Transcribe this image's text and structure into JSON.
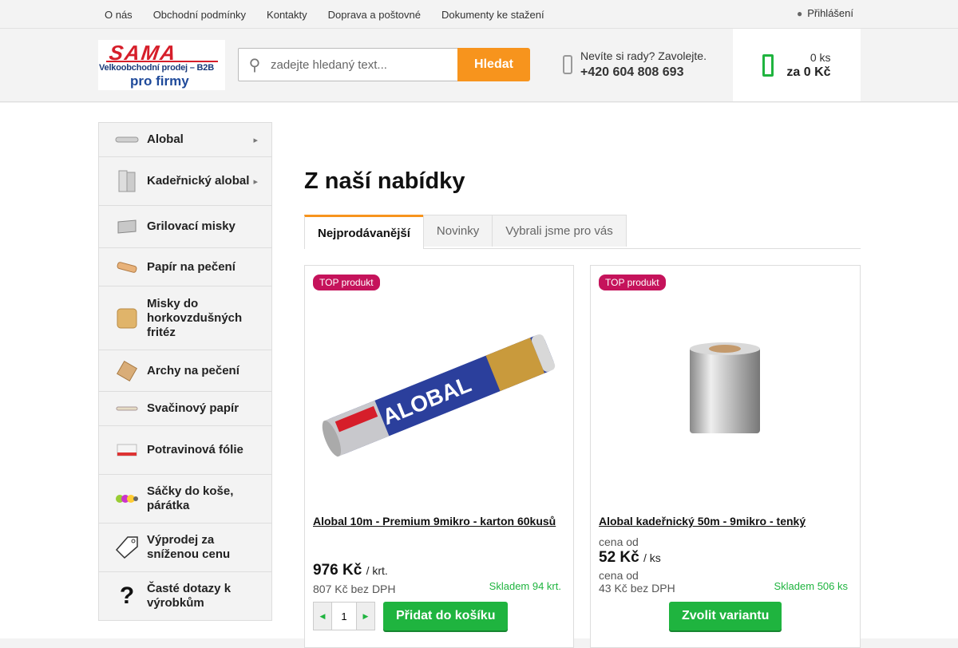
{
  "topnav": [
    "O nás",
    "Obchodní podmínky",
    "Kontakty",
    "Doprava a poštovné",
    "Dokumenty ke stažení"
  ],
  "login": "Přihlášení",
  "logo": {
    "brand": "SAMA",
    "sub": "Velkoobchodní prodej – B2B",
    "pro": "pro firmy"
  },
  "search": {
    "placeholder": "zadejte hledaný text...",
    "button": "Hledat"
  },
  "help": {
    "question": "Nevíte si rady? Zavolejte.",
    "phone": "+420 604 808 693"
  },
  "cart": {
    "qty": "0 ks",
    "sum": "za 0 Kč"
  },
  "categories": [
    {
      "label": "Alobal",
      "submenu": true
    },
    {
      "label": "Kadeřnický alobal",
      "submenu": true
    },
    {
      "label": "Grilovací misky",
      "submenu": false
    },
    {
      "label": "Papír na pečení",
      "submenu": false
    },
    {
      "label": "Misky do horkovzdušných fritéz",
      "submenu": false
    },
    {
      "label": "Archy na pečení",
      "submenu": false
    },
    {
      "label": "Svačinový papír",
      "submenu": false
    },
    {
      "label": "Potravinová fólie",
      "submenu": false
    },
    {
      "label": "Sáčky do koše, párátka",
      "submenu": false
    },
    {
      "label": "Výprodej za sníženou cenu",
      "submenu": false
    },
    {
      "label": "Časté dotazy k výrobkům",
      "submenu": false
    }
  ],
  "section_title": "Z naší nabídky",
  "tabs": [
    "Nejprodávanější",
    "Novinky",
    "Vybrali jsme pro vás"
  ],
  "products": [
    {
      "badge": "TOP produkt",
      "name": "Alobal 10m - Premium 9mikro - karton 60kusů",
      "price": "976 Kč",
      "unit": "/ krt.",
      "net": "807 Kč bez DPH",
      "stock": "Skladem 94 krt.",
      "qty": "1",
      "button": "Přidat do košíku",
      "roll_text": "ALOBAL"
    },
    {
      "badge": "TOP produkt",
      "name": "Alobal kadeřnický 50m - 9mikro - tenký",
      "price_from_label": "cena od",
      "price": "52 Kč",
      "unit": "/ ks",
      "net_from_label": "cena od",
      "net": "43 Kč bez DPH",
      "stock": "Skladem 506 ks",
      "button": "Zvolit variantu"
    }
  ]
}
